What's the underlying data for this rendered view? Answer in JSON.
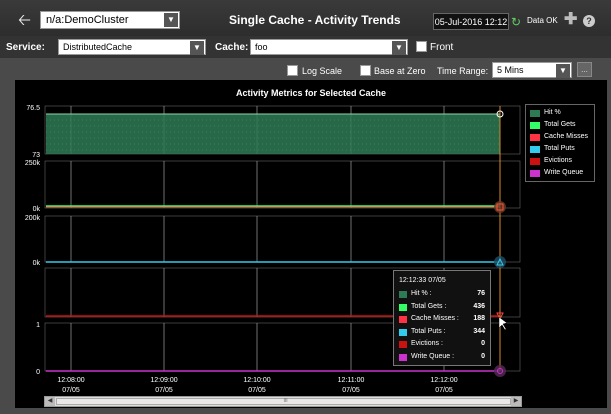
{
  "header": {
    "back_icon": "back-arrow-icon",
    "cluster": "n/a:DemoCluster",
    "title": "Single Cache - Activity Trends",
    "date": "05-Jul-2016 12:12",
    "data_status": "Data OK",
    "data_status_icon": "refresh-icon",
    "add_icon": "plus-icon",
    "help_icon": "help-icon"
  },
  "filters": {
    "service_label": "Service:",
    "service_value": "DistributedCache",
    "cache_label": "Cache:",
    "cache_value": "foo",
    "front_label": "Front",
    "front_checked": false
  },
  "options": {
    "log_scale_label": "Log Scale",
    "log_scale_checked": false,
    "base_at_zero_label": "Base at Zero",
    "base_at_zero_checked": false,
    "time_range_label": "Time Range:",
    "time_range_value": "5 Mins",
    "more_label": "..."
  },
  "chart_data": {
    "type": "line",
    "title": "Activity Metrics for Selected Cache",
    "x_ticks": [
      {
        "time": "12:08:00",
        "date": "07/05"
      },
      {
        "time": "12:09:00",
        "date": "07/05"
      },
      {
        "time": "12:10:00",
        "date": "07/05"
      },
      {
        "time": "12:11:00",
        "date": "07/05"
      },
      {
        "time": "12:12:00",
        "date": "07/05"
      }
    ],
    "panels": [
      {
        "series": [
          "Hit %"
        ],
        "ymax_label": "76.5",
        "ymin_label": "73",
        "type": "area"
      },
      {
        "series": [
          "Total Gets",
          "Cache Misses"
        ],
        "ymax_label": "250k",
        "ymin_label": "0k"
      },
      {
        "series": [
          "Total Puts"
        ],
        "ymax_label": "200k",
        "ymin_label": "0k"
      },
      {
        "series": [
          "Evictions"
        ],
        "ymax_label": "",
        "ymin_label": ""
      },
      {
        "series": [
          "Write Queue"
        ],
        "ymax_label": "1",
        "ymin_label": "0"
      }
    ],
    "legend": [
      {
        "name": "Hit %",
        "color": "#2e7a55"
      },
      {
        "name": "Total Gets",
        "color": "#33ff66"
      },
      {
        "name": "Cache Misses",
        "color": "#ff3344"
      },
      {
        "name": "Total Puts",
        "color": "#33ccee"
      },
      {
        "name": "Evictions",
        "color": "#cc1111"
      },
      {
        "name": "Write Queue",
        "color": "#cc33cc"
      }
    ],
    "grid": true,
    "legend_position": "right"
  },
  "tooltip": {
    "time": "12:12:33 07/05",
    "rows": [
      {
        "name": "Hit % :",
        "value": "76",
        "color": "#2e7a55"
      },
      {
        "name": "Total Gets :",
        "value": "436",
        "color": "#33ff66"
      },
      {
        "name": "Cache Misses :",
        "value": "188",
        "color": "#ff3344"
      },
      {
        "name": "Total Puts :",
        "value": "344",
        "color": "#33ccee"
      },
      {
        "name": "Evictions :",
        "value": "0",
        "color": "#cc1111"
      },
      {
        "name": "Write Queue :",
        "value": "0",
        "color": "#cc33cc"
      }
    ]
  },
  "scrollbar": {
    "left_icon": "scroll-left-icon",
    "right_icon": "scroll-right-icon",
    "grip": "III"
  }
}
